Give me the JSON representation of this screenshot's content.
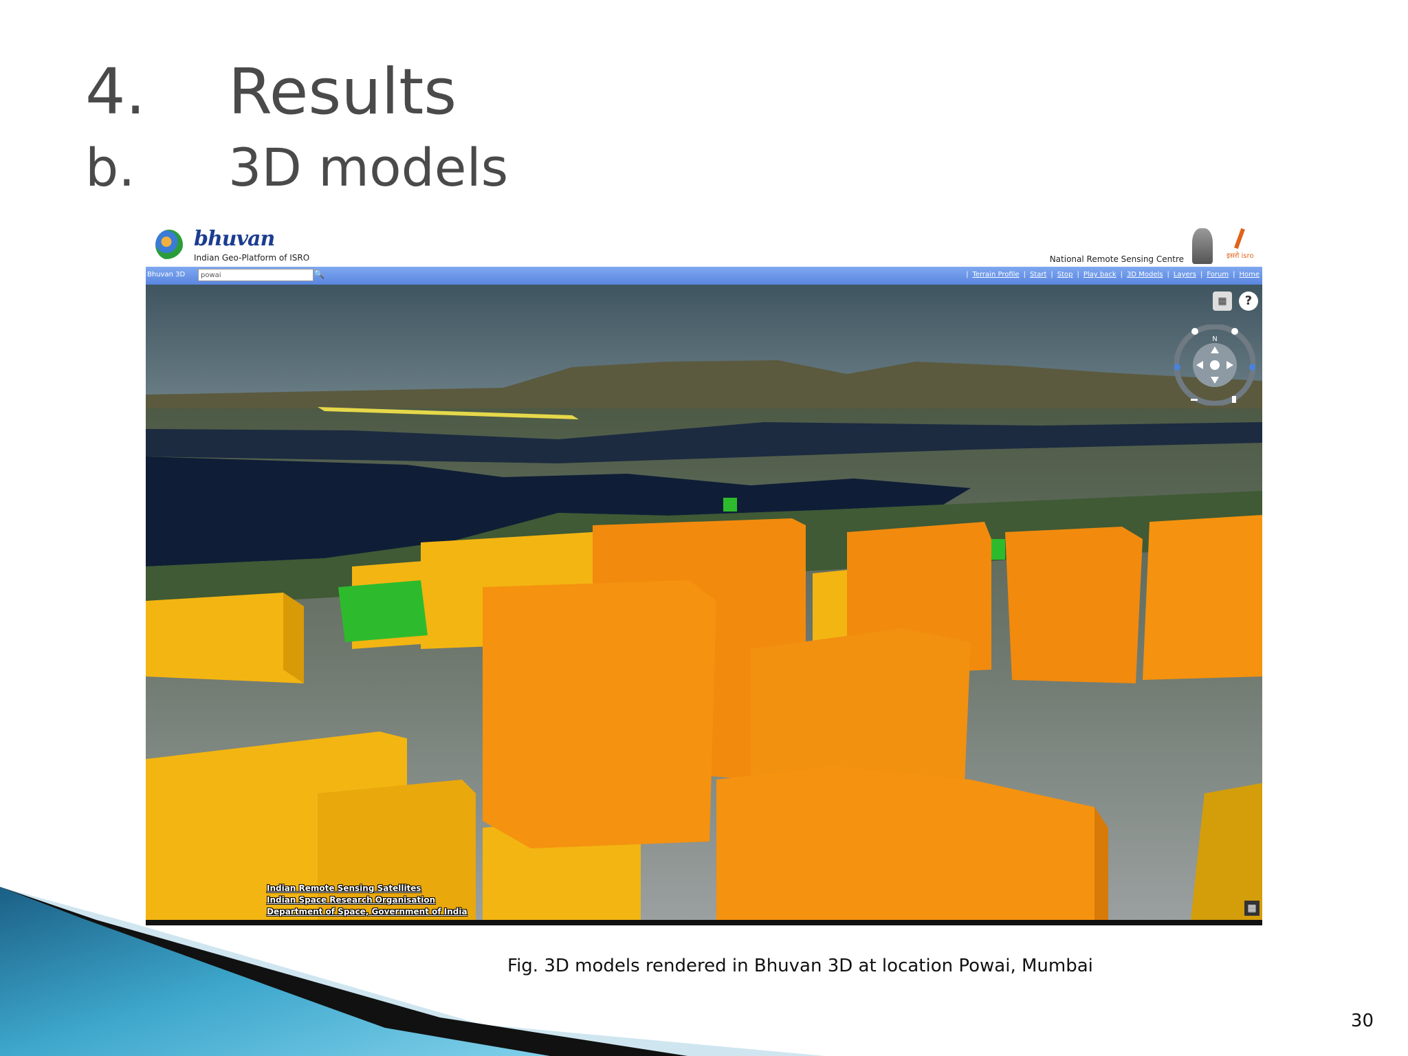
{
  "slide": {
    "title_number": "4.",
    "title_text": "Results",
    "subtitle_letter": "b.",
    "subtitle_text": "3D models",
    "caption": "Fig. 3D models rendered in Bhuvan 3D at location Powai, Mumbai",
    "page_number": "30"
  },
  "bhuvan": {
    "logo_text": "bhuvan",
    "tagline": "Indian Geo-Platform of ISRO",
    "org": "National Remote Sensing Centre",
    "isro_mark": "इसरो isro",
    "nav_label": "Bhuvan 3D",
    "search_value": "powai",
    "search_icon": "magnifier-icon",
    "nav_links": [
      "Terrain Profile",
      "Start",
      "Stop",
      "Play back",
      "3D Models",
      "Layers",
      "Forum",
      "Home"
    ],
    "help_label": "?",
    "credits": [
      "Indian Remote Sensing Satellites",
      "Indian Space Research Organisation",
      "Department of Space, Government of India"
    ],
    "compass_label": "N",
    "colors": {
      "nav_bar": "#5a86e0",
      "building_orange": "#f28a0e",
      "building_yellow": "#f3b512",
      "building_green": "#2dbb2d",
      "water": "#10213a",
      "sky": "#4e6470"
    }
  }
}
